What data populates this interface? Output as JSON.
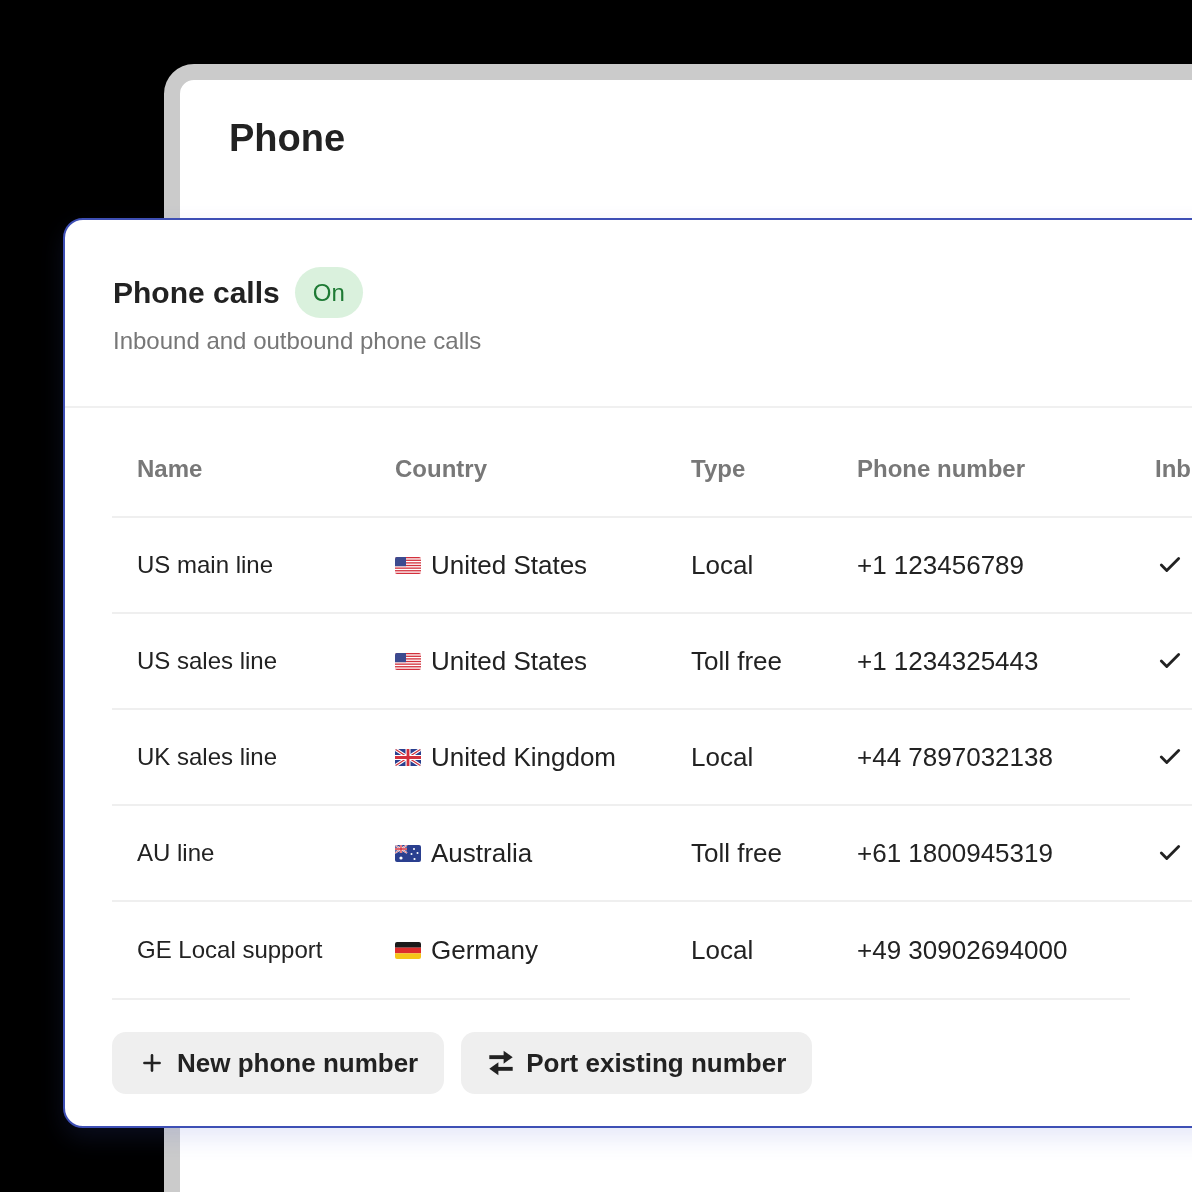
{
  "back_window": {
    "title": "Phone"
  },
  "card": {
    "title": "Phone calls",
    "status": {
      "label": "On",
      "on": true
    },
    "subtitle": "Inbound and outbound phone calls"
  },
  "table": {
    "columns": [
      "Name",
      "Country",
      "Type",
      "Phone number",
      "Inb"
    ],
    "rows": [
      {
        "name": "US main line",
        "country": {
          "kind": "us",
          "label": "United States"
        },
        "type": "Local",
        "phone_number": "+1 123456789",
        "checked": true
      },
      {
        "name": "US sales line",
        "country": {
          "kind": "us",
          "label": "United States"
        },
        "type": "Toll free",
        "phone_number": "+1 1234325443",
        "checked": true
      },
      {
        "name": "UK sales line",
        "country": {
          "kind": "gb",
          "label": "United Kingdom"
        },
        "type": "Local",
        "phone_number": "+44 7897032138",
        "checked": true
      },
      {
        "name": "AU line",
        "country": {
          "kind": "au",
          "label": "Australia"
        },
        "type": "Toll free",
        "phone_number": "+61 1800945319",
        "checked": true
      },
      {
        "name": "GE Local support",
        "country": {
          "kind": "de",
          "label": "Germany"
        },
        "type": "Local",
        "phone_number": "+49 30902694000",
        "checked": false
      }
    ]
  },
  "buttons": [
    {
      "kind": "add",
      "label": "New phone number"
    },
    {
      "kind": "port",
      "label": "Port existing number"
    }
  ]
}
